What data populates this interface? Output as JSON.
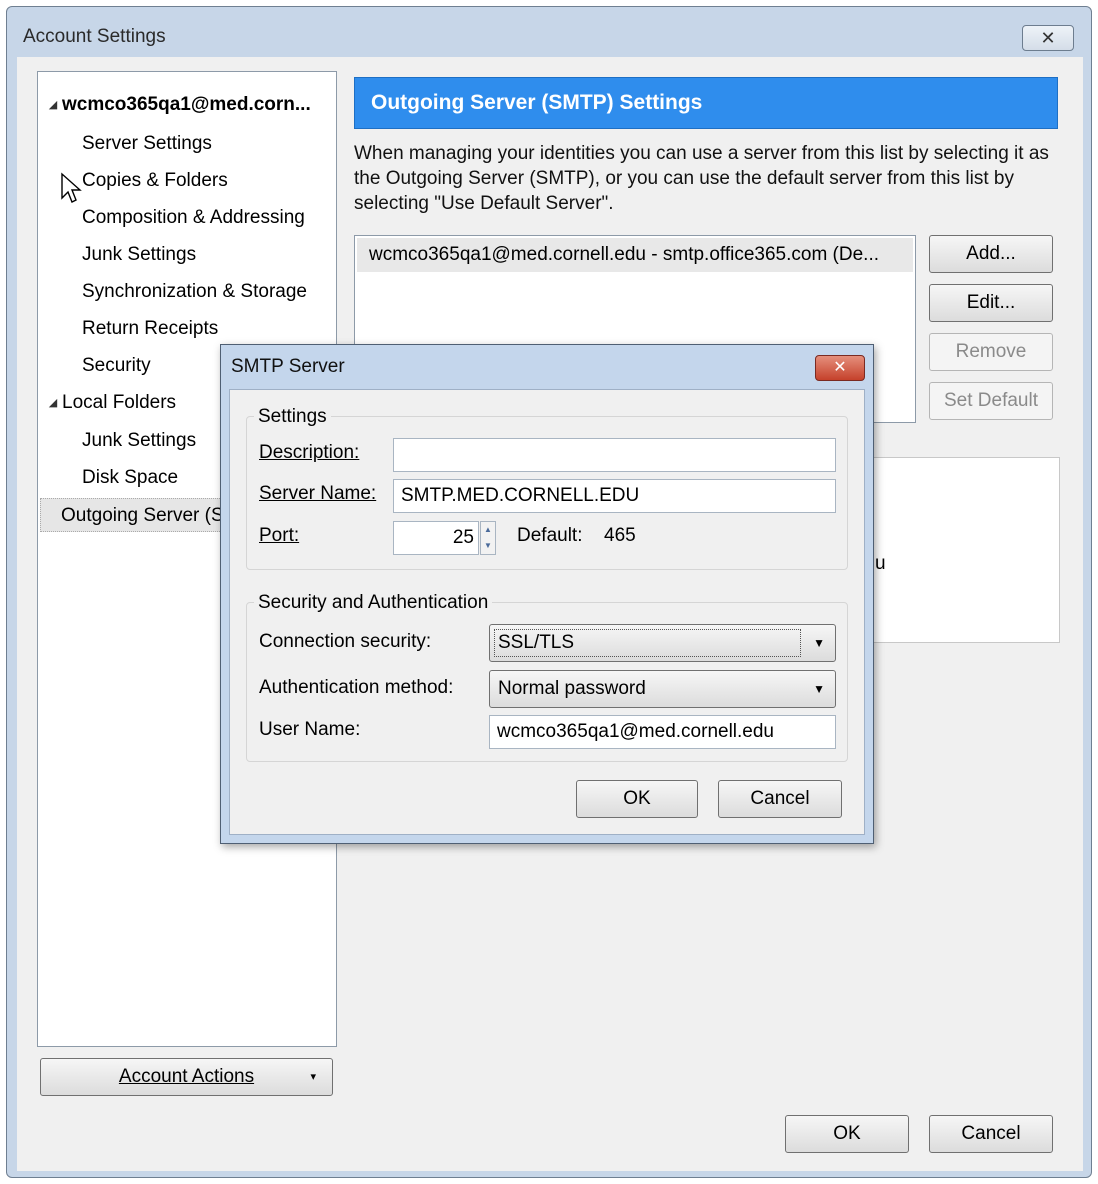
{
  "window": {
    "title": "Account Settings",
    "close_glyph": "✕"
  },
  "tree": {
    "items": [
      {
        "label": "wcmco365qa1@med.corn...",
        "bold": true
      },
      {
        "label": "Server Settings"
      },
      {
        "label": "Copies & Folders"
      },
      {
        "label": "Composition & Addressing"
      },
      {
        "label": "Junk Settings"
      },
      {
        "label": "Synchronization & Storage"
      },
      {
        "label": "Return Receipts"
      },
      {
        "label": "Security"
      },
      {
        "label": "Local Folders"
      },
      {
        "label": "Junk Settings"
      },
      {
        "label": "Disk Space"
      },
      {
        "label": "Outgoing Server (S"
      }
    ],
    "expand_glyph": "◢"
  },
  "account_actions": {
    "label": "Account Actions",
    "caret": "▾"
  },
  "panel": {
    "header": "Outgoing Server (SMTP) Settings",
    "description": "When managing your identities you can use a server from this list by selecting it as the Outgoing Server (SMTP), or you can use the default server from this list by selecting \"Use Default Server\".",
    "server_row": "wcmco365qa1@med.cornell.edu - smtp.office365.com (De...",
    "details_fragment": "u",
    "buttons": {
      "add": "Add...",
      "edit": "Edit...",
      "remove": "Remove",
      "set_default": "Set Default"
    }
  },
  "footer": {
    "ok": "OK",
    "cancel": "Cancel"
  },
  "smtp_dialog": {
    "title": "SMTP Server",
    "close_glyph": "✕",
    "settings_group": "Settings",
    "description_label": "Description:",
    "description_value": "",
    "server_name_label": "Server Name:",
    "server_name_value": "SMTP.MED.CORNELL.EDU",
    "port_label": "Port:",
    "port_value": "25",
    "default_label": "Default:",
    "default_value": "465",
    "security_group": "Security and Authentication",
    "connection_security_label": "Connection security:",
    "connection_security_value": "SSL/TLS",
    "auth_method_label": "Authentication method:",
    "auth_method_value": "Normal password",
    "user_name_label": "User Name:",
    "user_name_value": "wcmco365qa1@med.cornell.edu",
    "ok": "OK",
    "cancel": "Cancel",
    "dropdown_arrow": "▼",
    "spin_up": "▲",
    "spin_down": "▼"
  },
  "colors": {
    "header_blue": "#2f8ded",
    "dialog_frame": "#c4d6ec",
    "close_red": "#c5412b"
  }
}
